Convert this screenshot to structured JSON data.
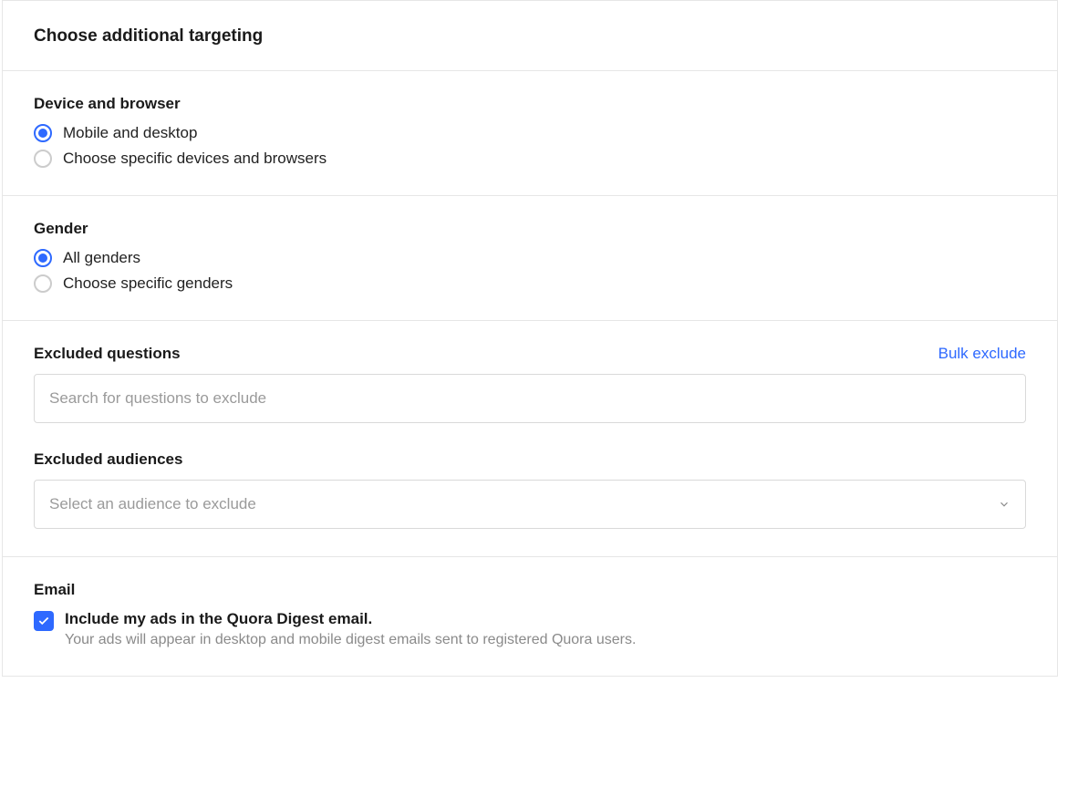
{
  "header": {
    "title": "Choose additional targeting"
  },
  "device": {
    "title": "Device and browser",
    "options": [
      {
        "label": "Mobile and desktop",
        "selected": true
      },
      {
        "label": "Choose specific devices and browsers",
        "selected": false
      }
    ]
  },
  "gender": {
    "title": "Gender",
    "options": [
      {
        "label": "All genders",
        "selected": true
      },
      {
        "label": "Choose specific genders",
        "selected": false
      }
    ]
  },
  "excluded_questions": {
    "title": "Excluded questions",
    "bulk_link": "Bulk exclude",
    "placeholder": "Search for questions to exclude"
  },
  "excluded_audiences": {
    "title": "Excluded audiences",
    "placeholder": "Select an audience to exclude"
  },
  "email": {
    "title": "Email",
    "checkbox_label": "Include my ads in the Quora Digest email.",
    "checkbox_desc": "Your ads will appear in desktop and mobile digest emails sent to registered Quora users.",
    "checked": true
  }
}
